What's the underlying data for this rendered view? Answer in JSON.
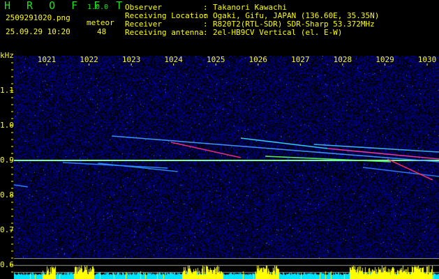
{
  "header": {
    "app_title": "H R O F F T",
    "version": "1.0.0",
    "filename": "2509291020.png",
    "datetime": "25.09.29 10:20",
    "meteor_label": "meteor",
    "meteor_count": "48",
    "info": [
      {
        "label": "Observer",
        "sep": ":",
        "value": "Takanori Kawachi"
      },
      {
        "label": "Receiving Location",
        "sep": ":",
        "value": "Ogaki, Gifu, JAPAN (136.60E, 35.35N)"
      },
      {
        "label": "Receiver",
        "sep": ":",
        "value": "R820T2(RTL-SDR) SDR-Sharp 53.372MHz"
      },
      {
        "label": "Receiving antenna",
        "sep": ":",
        "value": "2el-HB9CV Vertical (el. E-W)"
      }
    ]
  },
  "colors": {
    "text": "#ffff00",
    "title": "#22e022",
    "noise": "#1a1aa0",
    "histogram": "#ffff00",
    "histogram_base": "#00e5ff"
  },
  "chart_data": {
    "type": "heatmap",
    "title": "HROFFT spectrogram",
    "ylabel": "kHz",
    "xlabel": "",
    "x_ticks": [
      "1021",
      "1022",
      "1023",
      "1024",
      "1025",
      "1026",
      "1027",
      "1028",
      "1029",
      "1030"
    ],
    "y_ticks": [
      "1.1",
      "1.0",
      "0.9",
      "0.8",
      "0.7",
      "0.6"
    ],
    "ylim": [
      0.58,
      1.2
    ],
    "xlim": [
      1020.22,
      1030.28
    ],
    "carrier_khz": 0.9,
    "traces": [
      {
        "t0": 1022.54,
        "f0": 0.97,
        "t1": 1030.28,
        "f1": 0.896,
        "color": "#40a0ff"
      },
      {
        "t0": 1023.94,
        "f0": 0.952,
        "t1": 1025.59,
        "f1": 0.908,
        "color": "#ff3080"
      },
      {
        "t0": 1025.59,
        "f0": 0.964,
        "t1": 1027.65,
        "f1": 0.934,
        "color": "#30e0ff"
      },
      {
        "t0": 1027.65,
        "f0": 0.934,
        "t1": 1030.28,
        "f1": 0.904,
        "color": "#ff40a0"
      },
      {
        "t0": 1027.32,
        "f0": 0.946,
        "t1": 1030.28,
        "f1": 0.924,
        "color": "#40c0ff"
      },
      {
        "t0": 1028.48,
        "f0": 0.88,
        "t1": 1030.28,
        "f1": 0.854,
        "color": "#3080ff"
      },
      {
        "t0": 1029.06,
        "f0": 0.904,
        "t1": 1030.13,
        "f1": 0.844,
        "color": "#ff3060"
      },
      {
        "t0": 1021.38,
        "f0": 0.894,
        "t1": 1023.86,
        "f1": 0.878,
        "color": "#3090ff"
      },
      {
        "t0": 1022.21,
        "f0": 0.892,
        "t1": 1024.1,
        "f1": 0.868,
        "color": "#3090ff"
      },
      {
        "t0": 1020.22,
        "f0": 0.83,
        "t1": 1020.55,
        "f1": 0.824,
        "color": "#3090ff"
      },
      {
        "t0": 1026.17,
        "f0": 0.912,
        "t1": 1029.14,
        "f1": 0.896,
        "color": "#60ff60"
      }
    ]
  }
}
